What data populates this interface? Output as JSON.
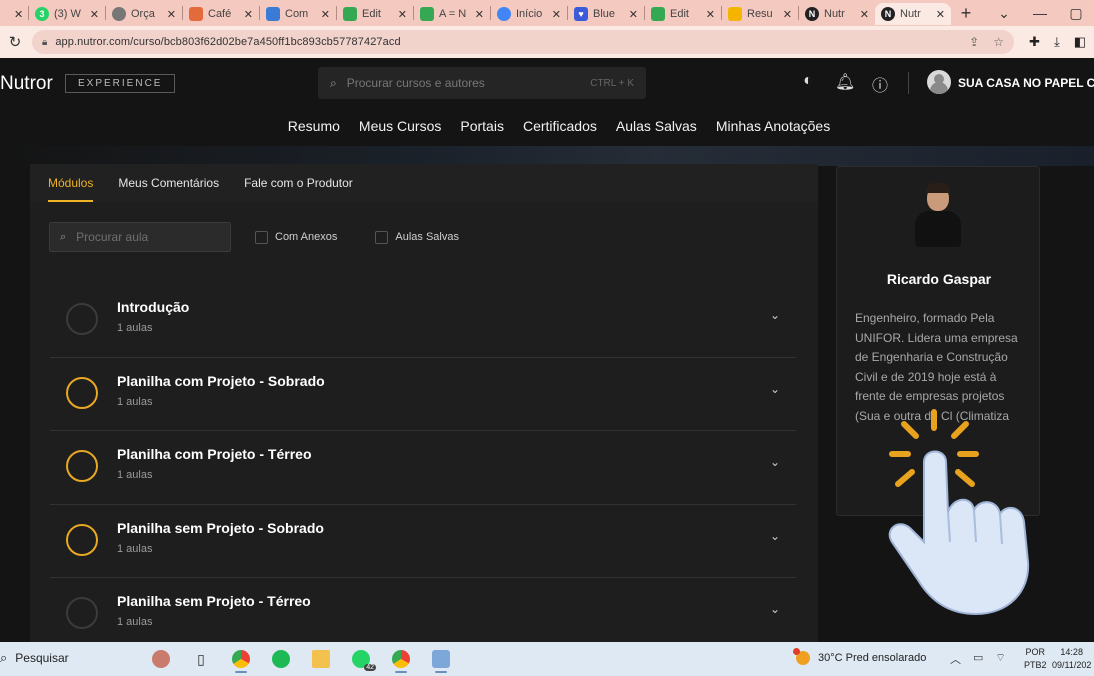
{
  "browser": {
    "tabs": [
      {
        "label": "",
        "favicon": "close",
        "color": "#f4c9bf"
      },
      {
        "label": "(3) W",
        "favicon": "whatsapp-icon",
        "color": "#25d366"
      },
      {
        "label": "Orça",
        "favicon": "globe-icon",
        "color": "#777777"
      },
      {
        "label": "Café",
        "favicon": "mail-icon",
        "color": "#e36b3b"
      },
      {
        "label": "Com",
        "favicon": "link-icon",
        "color": "#3a7bd5"
      },
      {
        "label": "Edit",
        "favicon": "sheet-icon",
        "color": "#34a853"
      },
      {
        "label": "A = N",
        "favicon": "sheet-icon",
        "color": "#34a853"
      },
      {
        "label": "Início",
        "favicon": "chrome-icon",
        "color": "#4285f4"
      },
      {
        "label": "Blue",
        "favicon": "heart-icon",
        "color": "#3b5bd9"
      },
      {
        "label": "Edit",
        "favicon": "sheet-icon",
        "color": "#34a853"
      },
      {
        "label": "Resu",
        "favicon": "notes-icon",
        "color": "#f4b400"
      },
      {
        "label": "Nutr",
        "favicon": "nutror-icon",
        "color": "#222222"
      },
      {
        "label": "Nutr",
        "favicon": "nutror-icon",
        "color": "#222222"
      }
    ],
    "new_tab": "+",
    "url": "app.nutror.com/curso/bcb803f62d02be7a450ff1bc893cb57787427acd"
  },
  "app": {
    "logo": "Nutror",
    "badge": "EXPERIENCE",
    "search": {
      "placeholder": "Procurar cursos e autores",
      "shortcut": "CTRL + K"
    },
    "user_name": "SUA CASA NO PAPEL CO",
    "main_nav": [
      "Resumo",
      "Meus Cursos",
      "Portais",
      "Certificados",
      "Aulas Salvas",
      "Minhas Anotações"
    ],
    "subtabs": [
      "Módulos",
      "Meus Comentários",
      "Fale com o Produtor"
    ],
    "lesson_search_placeholder": "Procurar aula",
    "filters": [
      "Com Anexos",
      "Aulas Salvas"
    ],
    "modules": [
      {
        "title": "Introdução",
        "count": "1 aulas",
        "active": false
      },
      {
        "title": "Planilha com Projeto - Sobrado",
        "count": "1 aulas",
        "active": true
      },
      {
        "title": "Planilha com Projeto - Térreo",
        "count": "1 aulas",
        "active": true
      },
      {
        "title": "Planilha sem Projeto - Sobrado",
        "count": "1 aulas",
        "active": true
      },
      {
        "title": "Planilha sem Projeto - Térreo",
        "count": "1 aulas",
        "active": false
      }
    ],
    "author": {
      "name": "Ricardo Gaspar",
      "bio": "Engenheiro, formado Pela UNIFOR. Lidera uma empresa de Engenharia e Construção Civil e de 2019 hoje está à frente de empresas projetos (Sua e outra de Cl (Climatiza"
    },
    "accent_color": "#f0b323"
  },
  "taskbar": {
    "search_label": "Pesquisar",
    "whatsapp_badge": "42",
    "weather": "30°C  Pred ensolarado",
    "lang_1": "POR",
    "lang_2": "PTB2",
    "time": "14:28",
    "date": "09/11/202"
  }
}
